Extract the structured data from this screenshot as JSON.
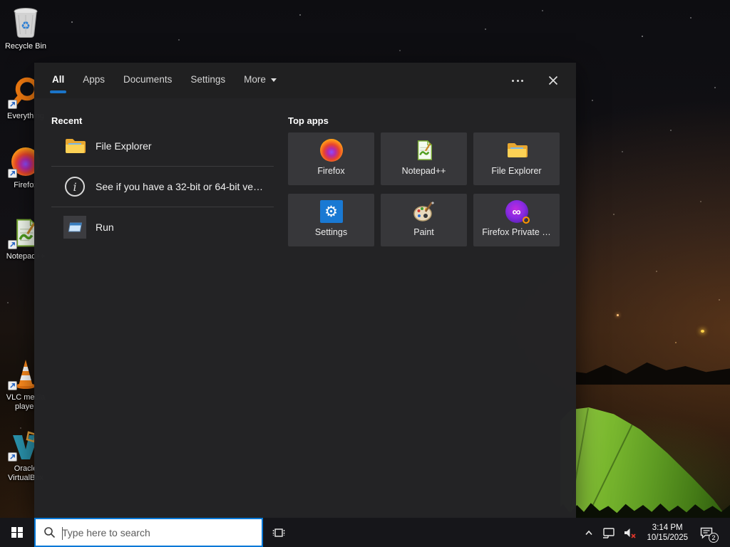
{
  "desktop": {
    "icons": [
      {
        "label": "Recycle Bin"
      },
      {
        "label": "Everything"
      },
      {
        "label": "Firefox"
      },
      {
        "label": "Notepad++"
      },
      {
        "label": "VLC media player"
      },
      {
        "label": "Oracle VirtualBox"
      }
    ]
  },
  "search_panel": {
    "tabs": [
      {
        "label": "All"
      },
      {
        "label": "Apps"
      },
      {
        "label": "Documents"
      },
      {
        "label": "Settings"
      },
      {
        "label": "More"
      }
    ],
    "recent": {
      "header": "Recent",
      "items": [
        {
          "label": "File Explorer"
        },
        {
          "label": "See if you have a 32-bit or 64-bit ve…"
        },
        {
          "label": "Run"
        }
      ]
    },
    "top_apps": {
      "header": "Top apps",
      "tiles": [
        {
          "label": "Firefox"
        },
        {
          "label": "Notepad++"
        },
        {
          "label": "File Explorer"
        },
        {
          "label": "Settings"
        },
        {
          "label": "Paint"
        },
        {
          "label": "Firefox Private …"
        }
      ]
    }
  },
  "taskbar": {
    "search": {
      "placeholder": "Type here to search"
    },
    "clock": {
      "time": "3:14 PM",
      "date": "10/15/2025"
    },
    "notifications": {
      "count": "2"
    }
  },
  "colors": {
    "accent": "#0078d7",
    "panel": "#242426",
    "tile": "#37373a",
    "taskbar": "#16161a",
    "tent_green": "#76b82a"
  }
}
